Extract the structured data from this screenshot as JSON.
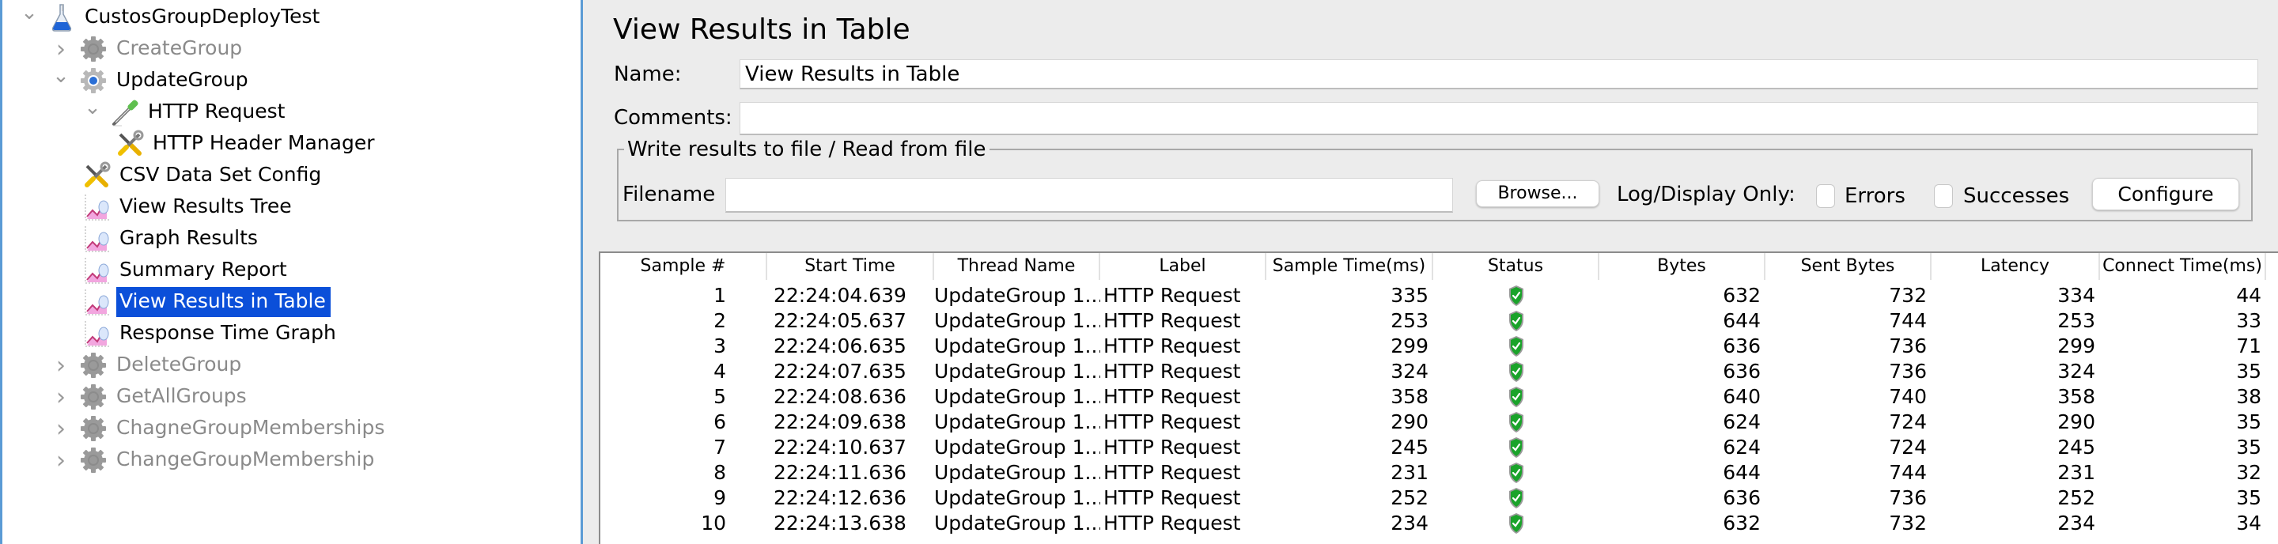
{
  "tree": {
    "items": [
      {
        "label": "CustosGroupDeployTest",
        "icon": "test-plan-flask-icon",
        "toggle": "expanded",
        "level": 0,
        "state": "normal"
      },
      {
        "label": "CreateGroup",
        "icon": "thread-group-gear-icon",
        "toggle": "collapsed",
        "level": 1,
        "state": "disabled"
      },
      {
        "label": "UpdateGroup",
        "icon": "thread-group-gear-icon",
        "toggle": "expanded",
        "level": 1,
        "state": "normal"
      },
      {
        "label": "HTTP Request",
        "icon": "sampler-pipette-icon",
        "toggle": "expanded",
        "level": 2,
        "state": "normal"
      },
      {
        "label": "HTTP Header Manager",
        "icon": "config-tools-icon",
        "toggle": "none",
        "level": 3,
        "state": "normal"
      },
      {
        "label": "CSV Data Set Config",
        "icon": "config-tools-icon",
        "toggle": "none",
        "level": 2,
        "state": "normal"
      },
      {
        "label": "View Results Tree",
        "icon": "listener-graph-icon",
        "toggle": "none",
        "level": 2,
        "state": "normal"
      },
      {
        "label": "Graph Results",
        "icon": "listener-graph-icon",
        "toggle": "none",
        "level": 2,
        "state": "normal"
      },
      {
        "label": "Summary Report",
        "icon": "listener-graph-icon",
        "toggle": "none",
        "level": 2,
        "state": "normal"
      },
      {
        "label": "View Results in Table",
        "icon": "listener-graph-icon",
        "toggle": "none",
        "level": 2,
        "state": "selected"
      },
      {
        "label": "Response Time Graph",
        "icon": "listener-graph-icon",
        "toggle": "none",
        "level": 2,
        "state": "normal"
      },
      {
        "label": "DeleteGroup",
        "icon": "thread-group-gear-icon",
        "toggle": "collapsed",
        "level": 1,
        "state": "disabled"
      },
      {
        "label": "GetAllGroups",
        "icon": "thread-group-gear-icon",
        "toggle": "collapsed",
        "level": 1,
        "state": "disabled"
      },
      {
        "label": "ChagneGroupMemberships",
        "icon": "thread-group-gear-icon",
        "toggle": "collapsed",
        "level": 1,
        "state": "disabled"
      },
      {
        "label": "ChangeGroupMembership",
        "icon": "thread-group-gear-icon",
        "toggle": "collapsed",
        "level": 1,
        "state": "disabled"
      }
    ]
  },
  "panel": {
    "title": "View Results in Table",
    "name_label": "Name:",
    "name_value": "View Results in Table",
    "comments_label": "Comments:",
    "comments_value": "",
    "file_group_title": "Write results to file / Read from file",
    "filename_label": "Filename",
    "filename_value": "",
    "browse_label": "Browse...",
    "log_display_label": "Log/Display Only:",
    "errors_label": "Errors",
    "errors_checked": false,
    "successes_label": "Successes",
    "successes_checked": false,
    "configure_label": "Configure"
  },
  "table": {
    "columns": [
      "Sample #",
      "Start Time",
      "Thread Name",
      "Label",
      "Sample Time(ms)",
      "Status",
      "Bytes",
      "Sent Bytes",
      "Latency",
      "Connect Time(ms)"
    ],
    "rows": [
      {
        "sample": "1",
        "start": "22:24:04.639",
        "thread": "UpdateGroup 1...",
        "label": "HTTP Request",
        "time": "335",
        "status": "success",
        "bytes": "632",
        "sent": "732",
        "latency": "334",
        "connect": "44"
      },
      {
        "sample": "2",
        "start": "22:24:05.637",
        "thread": "UpdateGroup 1...",
        "label": "HTTP Request",
        "time": "253",
        "status": "success",
        "bytes": "644",
        "sent": "744",
        "latency": "253",
        "connect": "33"
      },
      {
        "sample": "3",
        "start": "22:24:06.635",
        "thread": "UpdateGroup 1...",
        "label": "HTTP Request",
        "time": "299",
        "status": "success",
        "bytes": "636",
        "sent": "736",
        "latency": "299",
        "connect": "71"
      },
      {
        "sample": "4",
        "start": "22:24:07.635",
        "thread": "UpdateGroup 1...",
        "label": "HTTP Request",
        "time": "324",
        "status": "success",
        "bytes": "636",
        "sent": "736",
        "latency": "324",
        "connect": "35"
      },
      {
        "sample": "5",
        "start": "22:24:08.636",
        "thread": "UpdateGroup 1...",
        "label": "HTTP Request",
        "time": "358",
        "status": "success",
        "bytes": "640",
        "sent": "740",
        "latency": "358",
        "connect": "38"
      },
      {
        "sample": "6",
        "start": "22:24:09.638",
        "thread": "UpdateGroup 1...",
        "label": "HTTP Request",
        "time": "290",
        "status": "success",
        "bytes": "624",
        "sent": "724",
        "latency": "290",
        "connect": "35"
      },
      {
        "sample": "7",
        "start": "22:24:10.637",
        "thread": "UpdateGroup 1...",
        "label": "HTTP Request",
        "time": "245",
        "status": "success",
        "bytes": "624",
        "sent": "724",
        "latency": "245",
        "connect": "35"
      },
      {
        "sample": "8",
        "start": "22:24:11.636",
        "thread": "UpdateGroup 1...",
        "label": "HTTP Request",
        "time": "231",
        "status": "success",
        "bytes": "644",
        "sent": "744",
        "latency": "231",
        "connect": "32"
      },
      {
        "sample": "9",
        "start": "22:24:12.636",
        "thread": "UpdateGroup 1...",
        "label": "HTTP Request",
        "time": "252",
        "status": "success",
        "bytes": "636",
        "sent": "736",
        "latency": "252",
        "connect": "35"
      },
      {
        "sample": "10",
        "start": "22:24:13.638",
        "thread": "UpdateGroup 1...",
        "label": "HTTP Request",
        "time": "234",
        "status": "success",
        "bytes": "632",
        "sent": "732",
        "latency": "234",
        "connect": "34"
      }
    ]
  },
  "colors": {
    "selection": "#0b4fd9",
    "splitter": "#5b9bd5",
    "status_success": "#1aa32a",
    "disabled_text": "#8a8a8a"
  }
}
